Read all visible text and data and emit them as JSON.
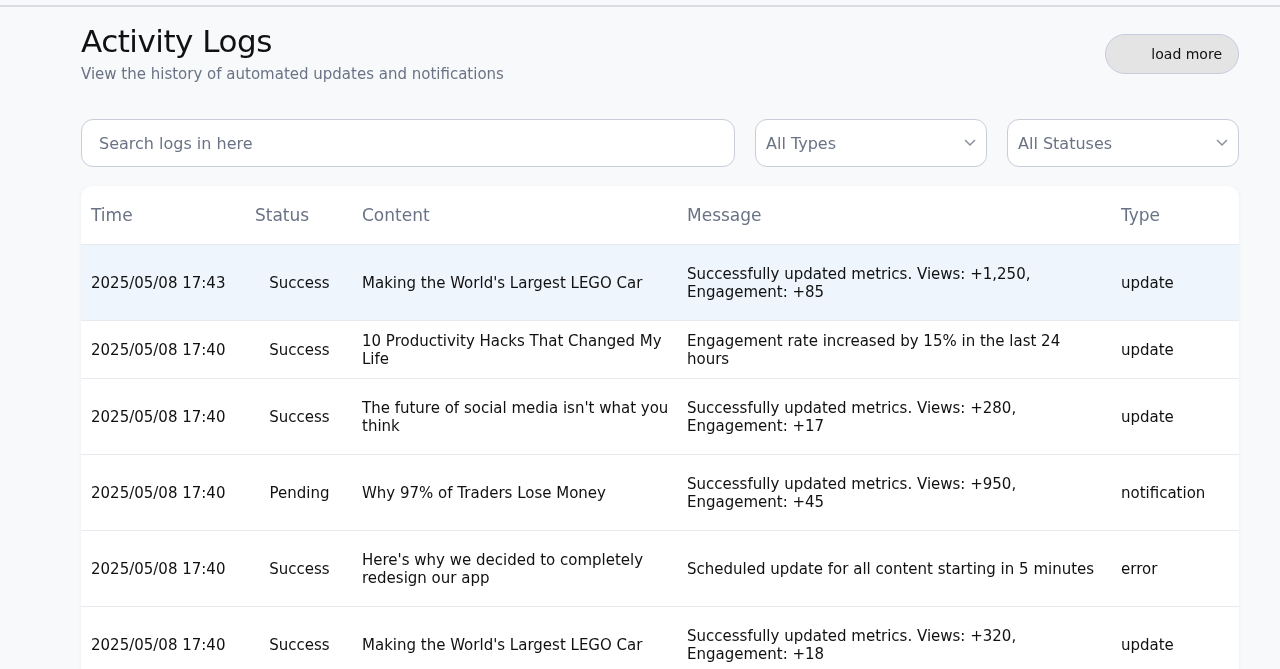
{
  "header": {
    "title": "Activity Logs",
    "subtitle": "View the history of automated updates and notifications",
    "load_more_button": "load more"
  },
  "filters": {
    "search": {
      "placeholder": "Search logs in here"
    },
    "type_select": {
      "value": "All Types"
    },
    "status_select": {
      "value": "All Statuses"
    }
  },
  "table": {
    "columns": [
      "Time",
      "Status",
      "Content",
      "Message",
      "Type"
    ],
    "rows": [
      {
        "selected": true,
        "time": "2025/05/08 17:43",
        "status": "Success",
        "content": "Making the World's Largest LEGO Car",
        "message": "Successfully updated metrics. Views: +1,250, Engagement: +85",
        "type": "update"
      },
      {
        "selected": false,
        "time": "2025/05/08 17:40",
        "status": "Success",
        "content": "10 Productivity Hacks That Changed My Life",
        "message": "Engagement rate increased by 15% in the last 24 hours",
        "type": "update"
      },
      {
        "selected": false,
        "time": "2025/05/08 17:40",
        "status": "Success",
        "content": "The future of social media isn't what you think",
        "message": "Successfully updated metrics. Views: +280, Engagement: +17",
        "type": "update"
      },
      {
        "selected": false,
        "time": "2025/05/08 17:40",
        "status": "Pending",
        "content": "Why 97% of Traders Lose Money",
        "message": "Successfully updated metrics. Views: +950, Engagement: +45",
        "type": "notification"
      },
      {
        "selected": false,
        "time": "2025/05/08 17:40",
        "status": "Success",
        "content": "Here's why we decided to completely redesign our app",
        "message": "Scheduled update for all content starting in 5 minutes",
        "type": "error"
      },
      {
        "selected": false,
        "time": "2025/05/08 17:40",
        "status": "Success",
        "content": "Making the World's Largest LEGO Car",
        "message": "Successfully updated metrics. Views: +320, Engagement: +18",
        "type": "update"
      }
    ]
  }
}
